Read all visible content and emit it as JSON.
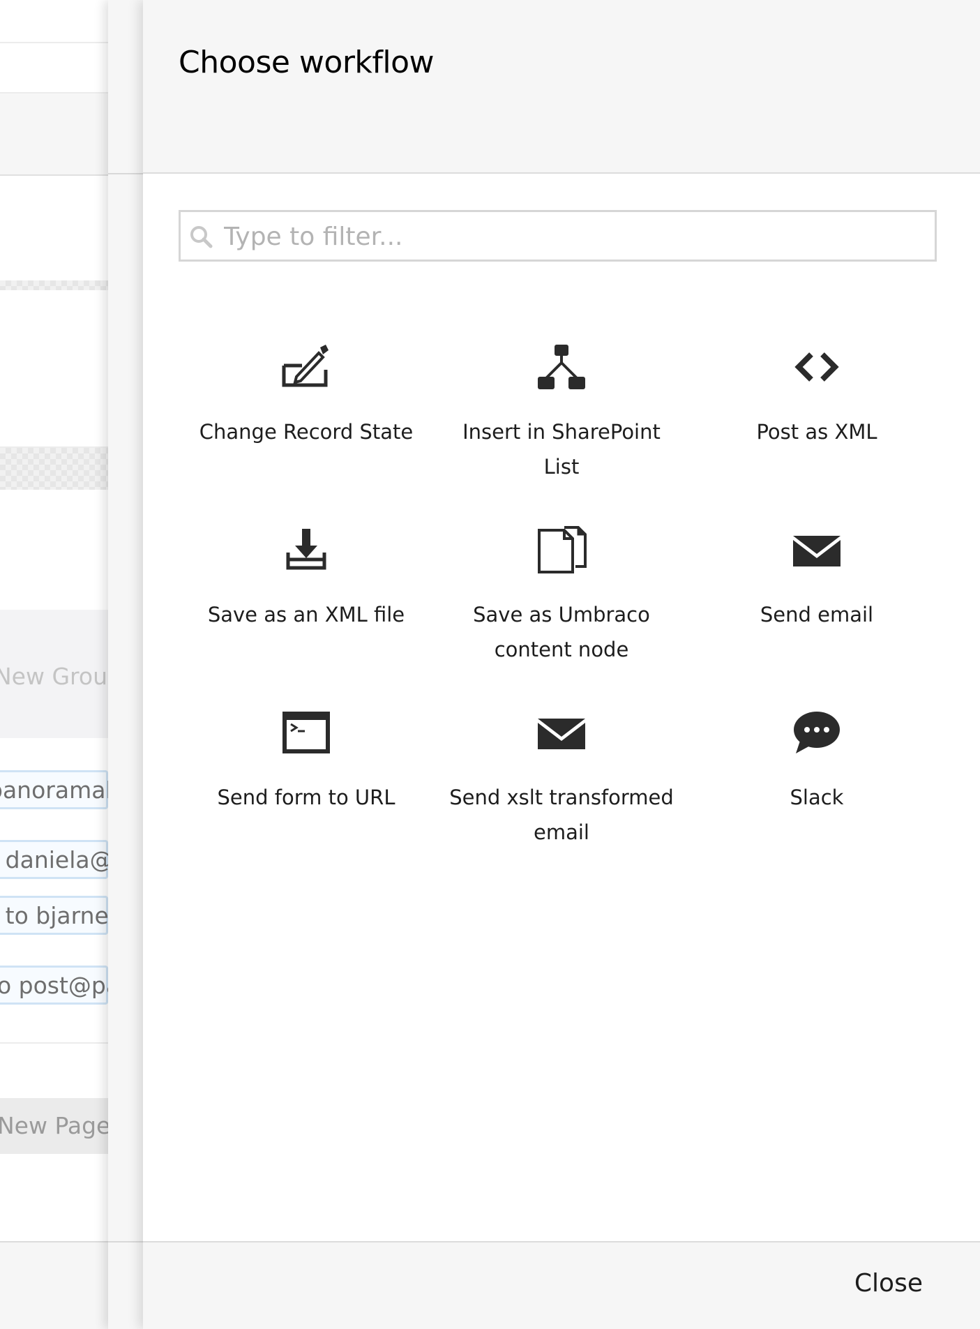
{
  "background": {
    "new_group_label": "New Group",
    "rows": [
      "panoramah",
      "o daniela@",
      "o to bjarne@",
      "to post@pa"
    ],
    "new_page_label": "New Page"
  },
  "panel": {
    "title": "Choose workflow",
    "filter": {
      "placeholder": "Type to filter..."
    },
    "workflows": [
      {
        "label": "Change Record State",
        "icon": "pencil-edit-icon"
      },
      {
        "label": "Insert in SharePoint List",
        "icon": "sitemap-icon"
      },
      {
        "label": "Post as XML",
        "icon": "code-brackets-icon"
      },
      {
        "label": "Save as an XML file",
        "icon": "download-icon"
      },
      {
        "label": "Save as Umbraco content node",
        "icon": "documents-icon"
      },
      {
        "label": "Send email",
        "icon": "envelope-icon"
      },
      {
        "label": "Send form to URL",
        "icon": "terminal-icon"
      },
      {
        "label": "Send xslt transformed email",
        "icon": "envelope-icon"
      },
      {
        "label": "Slack",
        "icon": "chat-bubble-icon"
      }
    ],
    "close_label": "Close"
  }
}
